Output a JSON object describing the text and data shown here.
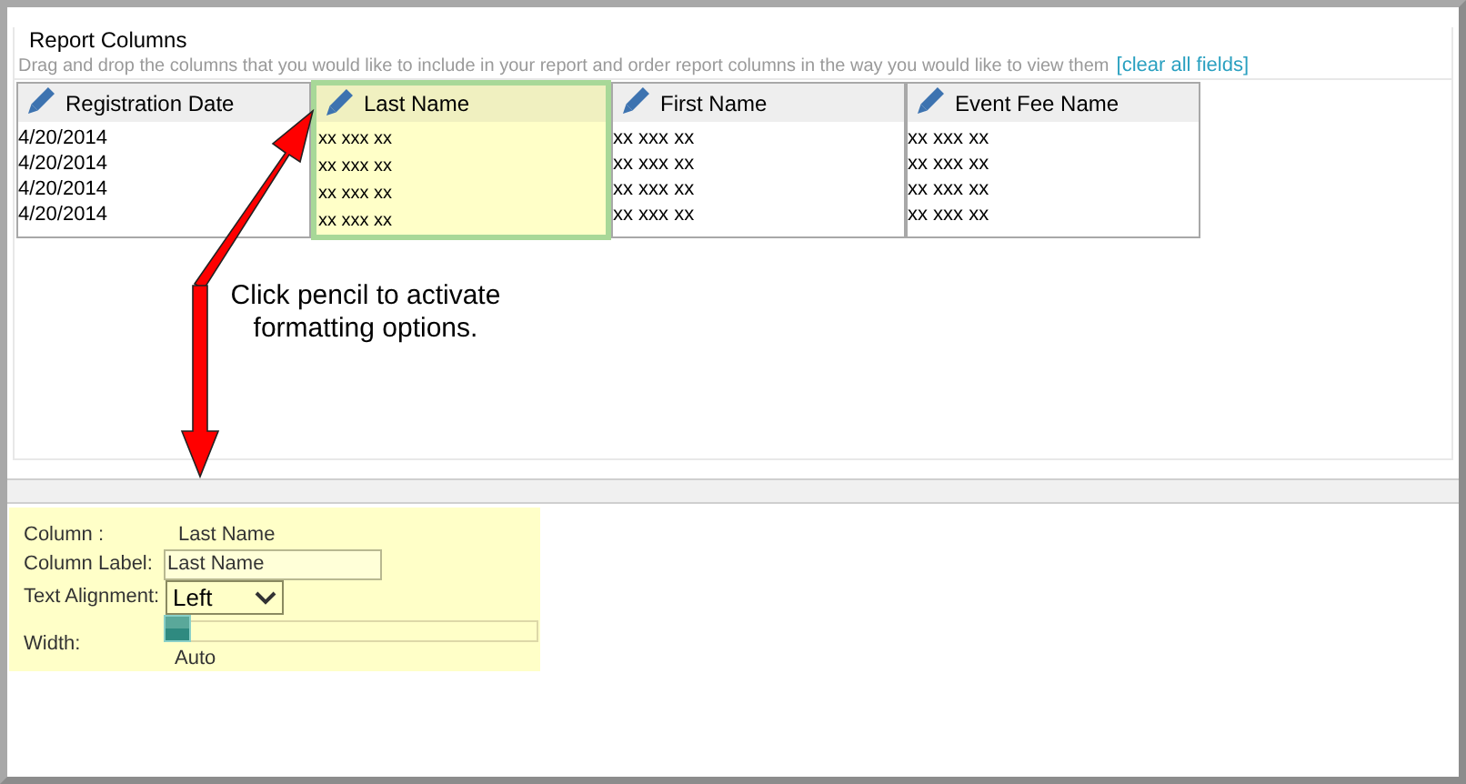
{
  "panel": {
    "title": "Report Columns",
    "instructions": "Drag and drop the columns that you would like to include in your report and order report columns in the way you would like to view them",
    "clear_link": "[clear all fields]"
  },
  "columns": [
    {
      "header": "Registration Date",
      "selected": false,
      "cells": [
        "4/20/2014",
        "4/20/2014",
        "4/20/2014",
        "4/20/2014"
      ]
    },
    {
      "header": "Last Name",
      "selected": true,
      "cells": [
        "xx xxx xx",
        "xx xxx xx",
        "xx xxx xx",
        "xx xxx xx"
      ]
    },
    {
      "header": "First Name",
      "selected": false,
      "cells": [
        "xx xxx xx",
        "xx xxx xx",
        "xx xxx xx",
        "xx xxx xx"
      ]
    },
    {
      "header": "Event Fee Name",
      "selected": false,
      "cells": [
        "xx xxx xx",
        "xx xxx xx",
        "xx xxx xx",
        "xx xxx xx"
      ]
    }
  ],
  "callout": "Click pencil to activate formatting options.",
  "format": {
    "column_label": "Column :",
    "column_value": "Last Name",
    "label_label": "Column Label:",
    "label_value": "Last Name",
    "alignment_label": "Text Alignment:",
    "alignment_value": "Left",
    "width_label": "Width:",
    "width": {
      "level": 0,
      "reading": "Auto"
    }
  }
}
